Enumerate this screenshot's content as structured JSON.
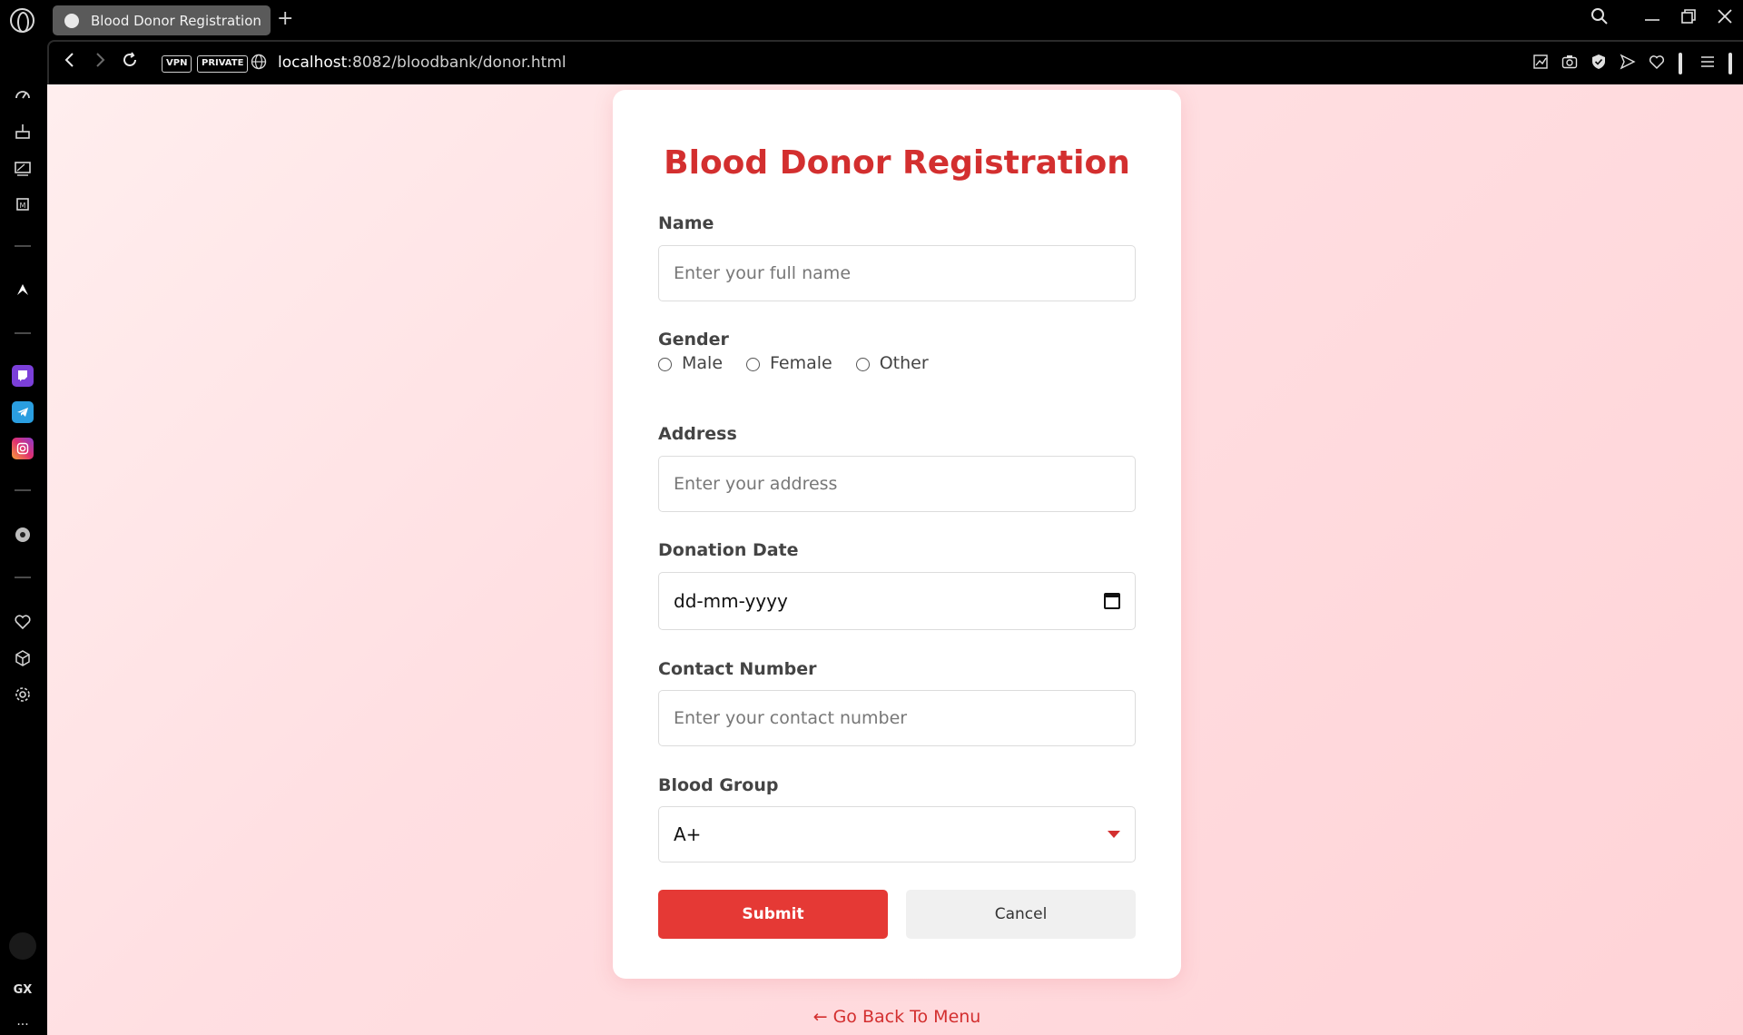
{
  "browser": {
    "tab_title": "Blood Donor Registration",
    "new_tab_label": "+",
    "url_host": "localhost",
    "url_path": ":8082/bloodbank/donor.html",
    "vpn_label": "VPN",
    "private_label": "PRIVATE"
  },
  "sidebar": {
    "gx_label": "GX",
    "more_label": "···"
  },
  "form": {
    "title": "Blood Donor Registration",
    "name_label": "Name",
    "name_placeholder": "Enter your full name",
    "gender_label": "Gender",
    "gender_options": [
      "Male",
      "Female",
      "Other"
    ],
    "address_label": "Address",
    "address_placeholder": "Enter your address",
    "date_label": "Donation Date",
    "date_placeholder": "dd-mm-yyyy",
    "contact_label": "Contact Number",
    "contact_placeholder": "Enter your contact number",
    "blood_group_label": "Blood Group",
    "blood_group_value": "A+",
    "submit_label": "Submit",
    "cancel_label": "Cancel"
  },
  "back_link": "← Go Back To Menu",
  "colors": {
    "accent": "#d32f2f",
    "submit_bg": "#e53935",
    "page_bg": "#ffdfe2"
  }
}
